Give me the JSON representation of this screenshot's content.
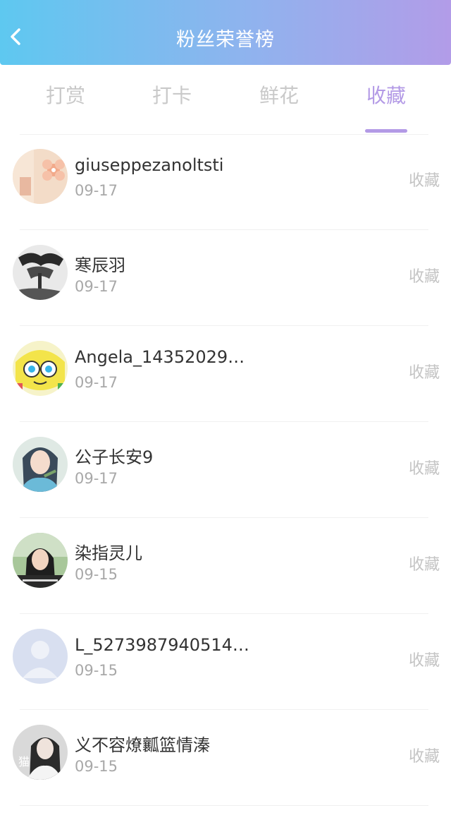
{
  "header": {
    "title": "粉丝荣誉榜",
    "back_icon": "chevron-left-icon"
  },
  "tabs": [
    {
      "label": "打赏",
      "active": false
    },
    {
      "label": "打卡",
      "active": false
    },
    {
      "label": "鲜花",
      "active": false
    },
    {
      "label": "收藏",
      "active": true
    }
  ],
  "colors": {
    "accent": "#b39ae6",
    "header_start": "#5ec8f0",
    "header_end": "#b29ce8"
  },
  "fans": [
    {
      "name": "giuseppezanoltsti",
      "date": "09-17",
      "action": "收藏",
      "avatar": "flower-avatar"
    },
    {
      "name": "寒辰羽",
      "date": "09-17",
      "action": "收藏",
      "avatar": "ink-painting-avatar"
    },
    {
      "name": "Angela_14352029…",
      "date": "09-17",
      "action": "收藏",
      "avatar": "cartoon-avatar"
    },
    {
      "name": "公子长安9",
      "date": "09-17",
      "action": "收藏",
      "avatar": "anime-girl-avatar"
    },
    {
      "name": "染指灵儿",
      "date": "09-15",
      "action": "收藏",
      "avatar": "girl-photo-avatar"
    },
    {
      "name": "L_5273987940514…",
      "date": "09-15",
      "action": "收藏",
      "avatar": "default-user-avatar"
    },
    {
      "name": "义不容燎瓤篮情溱",
      "date": "09-15",
      "action": "收藏",
      "avatar": "girl-cat-avatar",
      "avatar_text": "猫"
    }
  ]
}
